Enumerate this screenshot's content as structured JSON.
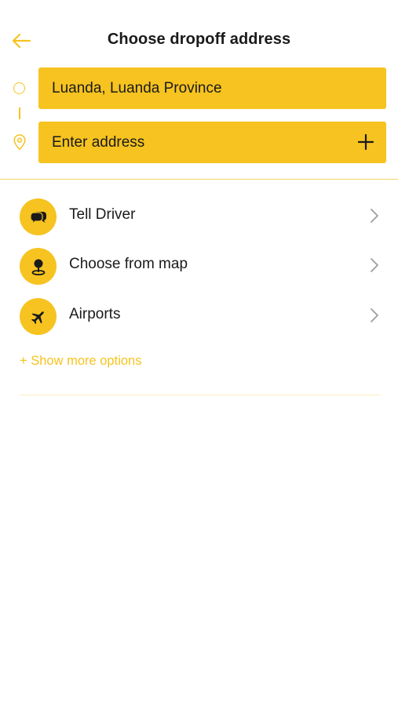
{
  "header": {
    "title": "Choose dropoff address"
  },
  "route": {
    "origin_value": "Luanda, Luanda Province",
    "destination_placeholder": "Enter address"
  },
  "options": [
    {
      "label": "Tell Driver",
      "icon": "chat-bubbles-icon"
    },
    {
      "label": "Choose from map",
      "icon": "map-pin-icon"
    },
    {
      "label": "Airports",
      "icon": "airplane-icon"
    }
  ],
  "more_options_label": "+ Show more options",
  "colors": {
    "accent": "#f6c320",
    "text": "#1a1a1a",
    "chevron": "#9e9e9e"
  }
}
